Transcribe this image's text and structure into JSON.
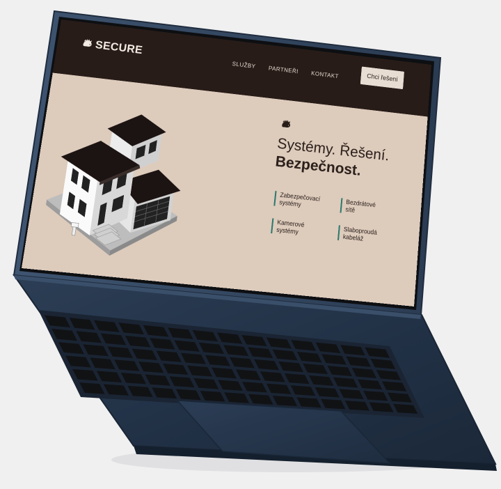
{
  "site": {
    "logo_text": "SECURE",
    "nav": [
      {
        "label": "SLUŽBY"
      },
      {
        "label": "PARTNEŘI"
      },
      {
        "label": "KONTAKT"
      }
    ],
    "cta_label": "Chci řešení"
  },
  "hero": {
    "line1": "Systémy. Řešení.",
    "line2": "Bezpečnost."
  },
  "services": [
    {
      "line1": "Zabezpečovací",
      "line2": "systémy"
    },
    {
      "line1": "Bezdrátové",
      "line2": "sítě"
    },
    {
      "line1": "Kamerové",
      "line2": "systémy"
    },
    {
      "line1": "Slaboproudá",
      "line2": "kabeláž"
    }
  ],
  "colors": {
    "background": "#f0f0f1",
    "laptop_body": "#24354a",
    "screen_bg": "#ddcbbc",
    "nav_bg": "#281c18",
    "accent": "#2f7a6f"
  },
  "icons": [
    "hedgehog-logo-icon",
    "hedgehog-icon",
    "isometric-house-illustration"
  ]
}
